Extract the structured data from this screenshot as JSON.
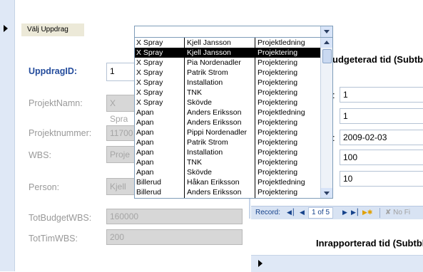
{
  "combo": {
    "label": "Välj Uppdrag",
    "value": ""
  },
  "dropdown_rows": [
    {
      "c1": "X Spray",
      "c2": "Kjell Jansson",
      "c3": "Projektledning",
      "selected": false
    },
    {
      "c1": "X Spray",
      "c2": "Kjell Jansson",
      "c3": "Projektering",
      "selected": true
    },
    {
      "c1": "X Spray",
      "c2": "Pia Nordenadler",
      "c3": "Projektering",
      "selected": false
    },
    {
      "c1": "X Spray",
      "c2": "Patrik Strom",
      "c3": "Projektering",
      "selected": false
    },
    {
      "c1": "X Spray",
      "c2": "Installation",
      "c3": "Projektering",
      "selected": false
    },
    {
      "c1": "X Spray",
      "c2": "TNK",
      "c3": "Projektering",
      "selected": false
    },
    {
      "c1": "X Spray",
      "c2": "Skövde",
      "c3": "Projektering",
      "selected": false
    },
    {
      "c1": "Apan",
      "c2": "Anders Eriksson",
      "c3": "Projektledning",
      "selected": false
    },
    {
      "c1": "Apan",
      "c2": "Anders Eriksson",
      "c3": "Projektering",
      "selected": false
    },
    {
      "c1": "Apan",
      "c2": "Pippi Nordenadler",
      "c3": "Projektering",
      "selected": false
    },
    {
      "c1": "Apan",
      "c2": "Patrik Strom",
      "c3": "Projektering",
      "selected": false
    },
    {
      "c1": "Apan",
      "c2": "Installation",
      "c3": "Projektering",
      "selected": false
    },
    {
      "c1": "Apan",
      "c2": "TNK",
      "c3": "Projektering",
      "selected": false
    },
    {
      "c1": "Apan",
      "c2": "Skövde",
      "c3": "Projektering",
      "selected": false
    },
    {
      "c1": "Billerud",
      "c2": "Håkan Eriksson",
      "c3": "Projektledning",
      "selected": false
    },
    {
      "c1": "Billerud",
      "c2": "Anders Eriksson",
      "c3": "Projektering",
      "selected": false
    }
  ],
  "form": {
    "uppdragid_label": "UppdragID:",
    "uppdragid_value": "1",
    "projektnamn_label": "ProjektNamn:",
    "projektnamn_value": "X Spra",
    "projektnummer_label": "Projektnummer:",
    "projektnummer_value": "11700",
    "wbs_label": "WBS:",
    "wbs_value": "Proje",
    "person_label": "Person:",
    "person_value": "Kjell",
    "totbudgetwbs_label": "TotBudgetWBS:",
    "totbudgetwbs_value": "160000",
    "tottimwbs_label": "TotTimWBS:",
    "tottimwbs_value": "200"
  },
  "subform1": {
    "title": "udgeterad tid (Subtbl",
    "fields": [
      "1",
      "1",
      "2009-02-03",
      "100",
      "10"
    ]
  },
  "navbar": {
    "record_label": "Record:",
    "position": "1 of 5",
    "filter_label": "No Fi"
  },
  "subform2": {
    "title": "Inrapporterad tid (Subtbl"
  }
}
